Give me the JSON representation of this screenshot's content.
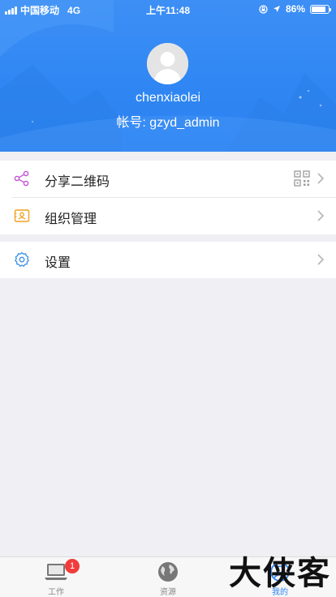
{
  "status_bar": {
    "carrier": "中国移动",
    "network": "4G",
    "time": "上午11:48",
    "battery_percent": "86%",
    "battery_level": 0.86
  },
  "profile": {
    "username": "chenxiaolei",
    "account": "帐号: gzyd_admin"
  },
  "menu": {
    "share_qr": "分享二维码",
    "org_manage": "组织管理",
    "settings": "设置"
  },
  "tabs": [
    {
      "label": "工作",
      "badge": "1"
    },
    {
      "label": "资源"
    },
    {
      "label": "我的"
    }
  ],
  "watermark": "大侠客",
  "colors": {
    "header_blue": "#2f86f3",
    "active_tab": "#2f86f3",
    "share_icon": "#c452d6",
    "org_icon": "#f0a020",
    "settings_icon": "#3a8ee6",
    "badge": "#f03c3c"
  }
}
